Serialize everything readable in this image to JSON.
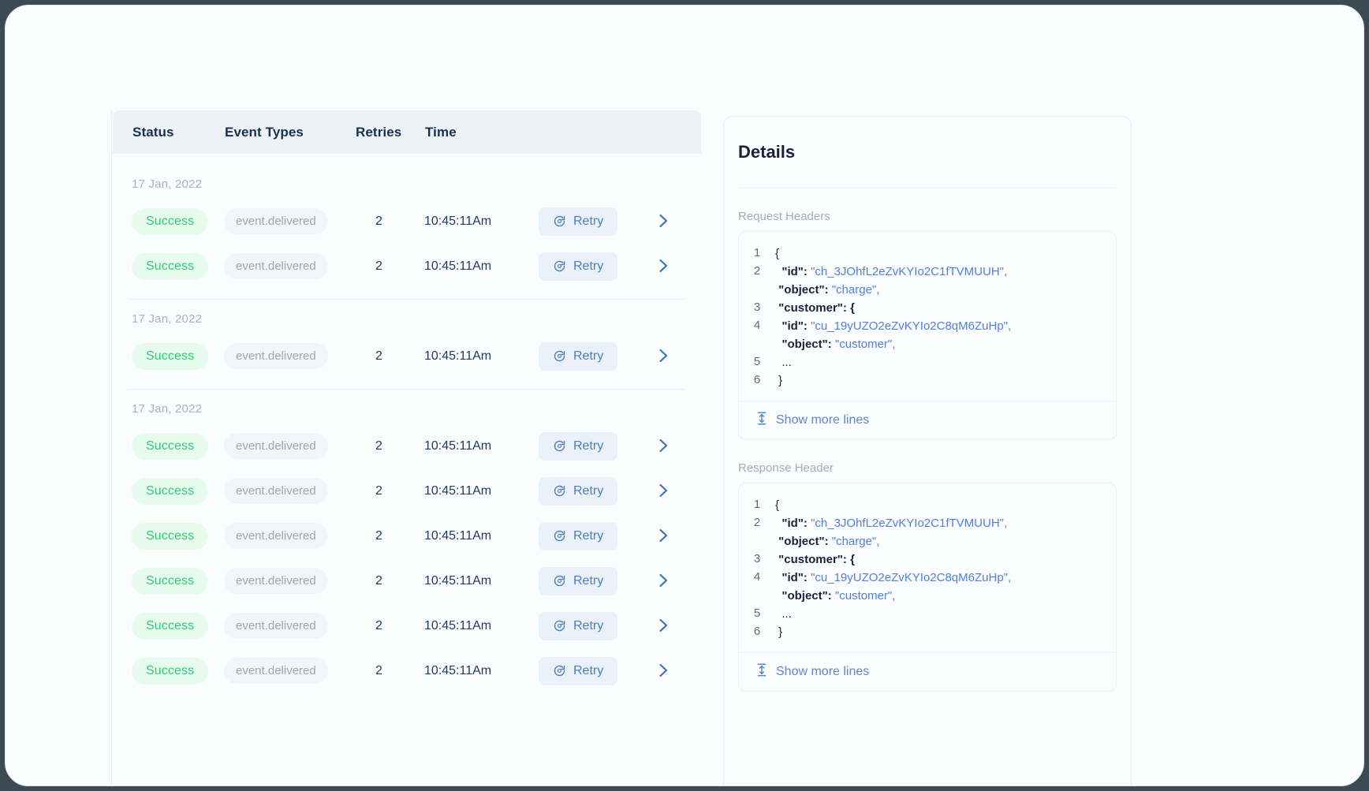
{
  "table": {
    "columns": [
      "Status",
      "Event Types",
      "Retries",
      "Time",
      "",
      ""
    ],
    "groups": [
      {
        "date": "17 Jan, 2022",
        "rows": [
          {
            "status": "Success",
            "event_type": "event.delivered",
            "retries": "2",
            "time": "10:45:11Am",
            "action": "Retry"
          },
          {
            "status": "Success",
            "event_type": "event.delivered",
            "retries": "2",
            "time": "10:45:11Am",
            "action": "Retry"
          }
        ]
      },
      {
        "date": "17 Jan, 2022",
        "rows": [
          {
            "status": "Success",
            "event_type": "event.delivered",
            "retries": "2",
            "time": "10:45:11Am",
            "action": "Retry"
          }
        ]
      },
      {
        "date": "17 Jan, 2022",
        "rows": [
          {
            "status": "Success",
            "event_type": "event.delivered",
            "retries": "2",
            "time": "10:45:11Am",
            "action": "Retry"
          },
          {
            "status": "Success",
            "event_type": "event.delivered",
            "retries": "2",
            "time": "10:45:11Am",
            "action": "Retry"
          },
          {
            "status": "Success",
            "event_type": "event.delivered",
            "retries": "2",
            "time": "10:45:11Am",
            "action": "Retry"
          },
          {
            "status": "Success",
            "event_type": "event.delivered",
            "retries": "2",
            "time": "10:45:11Am",
            "action": "Retry"
          },
          {
            "status": "Success",
            "event_type": "event.delivered",
            "retries": "2",
            "time": "10:45:11Am",
            "action": "Retry"
          },
          {
            "status": "Success",
            "event_type": "event.delivered",
            "retries": "2",
            "time": "10:45:11Am",
            "action": "Retry"
          }
        ]
      }
    ]
  },
  "details": {
    "title": "Details",
    "sections": [
      {
        "label": "Request Headers",
        "show_more_label": "Show more lines",
        "lines": [
          {
            "n": "1",
            "segments": [
              {
                "t": "{",
                "k": "plain"
              }
            ]
          },
          {
            "n": "2",
            "segments": [
              {
                "t": "  \"id\": ",
                "k": "key"
              },
              {
                "t": "\"ch_3JOhfL2eZvKYIo2C1fTVMUUH\",",
                "k": "val"
              },
              {
                "t": "\n \"object\": ",
                "k": "key"
              },
              {
                "t": "\"charge\",",
                "k": "val"
              }
            ]
          },
          {
            "n": "3",
            "segments": [
              {
                "t": " \"customer\": {",
                "k": "key"
              }
            ]
          },
          {
            "n": "4",
            "segments": [
              {
                "t": "  \"id\": ",
                "k": "key"
              },
              {
                "t": "\"cu_19yUZO2eZvKYIo2C8qM6ZuHp\",",
                "k": "val"
              },
              {
                "t": "\n  \"object\": ",
                "k": "key"
              },
              {
                "t": "\"customer\",",
                "k": "val"
              }
            ]
          },
          {
            "n": "5",
            "segments": [
              {
                "t": "  ...",
                "k": "dots"
              }
            ]
          },
          {
            "n": "6",
            "segments": [
              {
                "t": " }",
                "k": "plain"
              }
            ]
          }
        ]
      },
      {
        "label": "Response Header",
        "show_more_label": "Show more lines",
        "lines": [
          {
            "n": "1",
            "segments": [
              {
                "t": "{",
                "k": "plain"
              }
            ]
          },
          {
            "n": "2",
            "segments": [
              {
                "t": "  \"id\": ",
                "k": "key"
              },
              {
                "t": "\"ch_3JOhfL2eZvKYIo2C1fTVMUUH\",",
                "k": "val"
              },
              {
                "t": "\n \"object\": ",
                "k": "key"
              },
              {
                "t": "\"charge\",",
                "k": "val"
              }
            ]
          },
          {
            "n": "3",
            "segments": [
              {
                "t": " \"customer\": {",
                "k": "key"
              }
            ]
          },
          {
            "n": "4",
            "segments": [
              {
                "t": "  \"id\": ",
                "k": "key"
              },
              {
                "t": "\"cu_19yUZO2eZvKYIo2C8qM6ZuHp\",",
                "k": "val"
              },
              {
                "t": "\n  \"object\": ",
                "k": "key"
              },
              {
                "t": "\"customer\",",
                "k": "val"
              }
            ]
          },
          {
            "n": "5",
            "segments": [
              {
                "t": "  ...",
                "k": "dots"
              }
            ]
          },
          {
            "n": "6",
            "segments": [
              {
                "t": " }",
                "k": "plain"
              }
            ]
          }
        ]
      }
    ]
  },
  "icons": {
    "retry": "retry-icon",
    "chevron_right": "chevron-right-icon",
    "expand_vertical": "expand-vertical-icon"
  },
  "colors": {
    "page_background": "#3b4a53",
    "shell_background": "#fbfcfd",
    "header_background": "#edf2f7",
    "success_text": "#2ecc71",
    "success_background": "#e8fbef",
    "accent_blue": "#4f7fe0",
    "retry_background": "#eaf1f8"
  }
}
